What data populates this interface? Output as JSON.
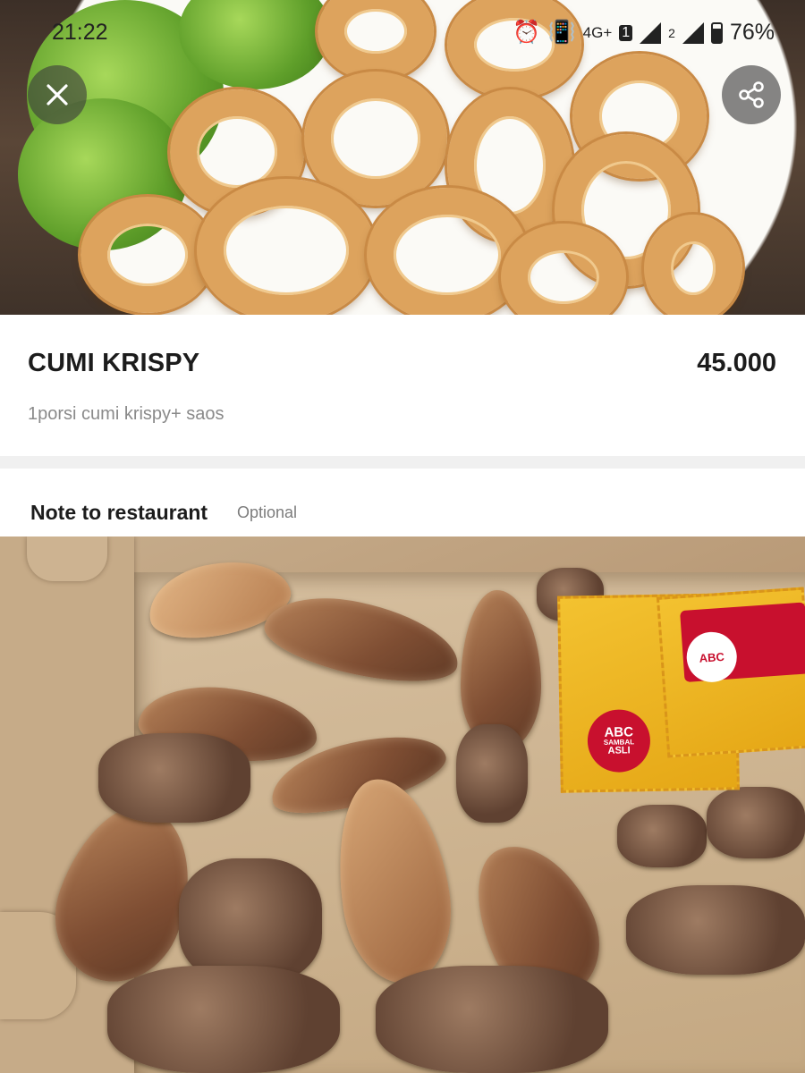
{
  "status_bar": {
    "time": "21:22",
    "network": "4G+",
    "sim_badge": "1",
    "sim2": "2",
    "battery": "76%"
  },
  "product": {
    "name": "CUMI KRISPY",
    "price": "45.000",
    "description": "1porsi cumi krispy+ saos"
  },
  "note": {
    "label": "Note to restaurant",
    "optional": "Optional"
  },
  "sachet": {
    "brand": "ABC",
    "line1": "SAMBAL",
    "line2": "ASLI"
  },
  "icons": {
    "close": "close-icon",
    "share": "share-icon"
  },
  "colors": {
    "text_primary": "#1c1c1c",
    "text_secondary": "#8a8a8a",
    "divider": "#f0f0f0"
  }
}
